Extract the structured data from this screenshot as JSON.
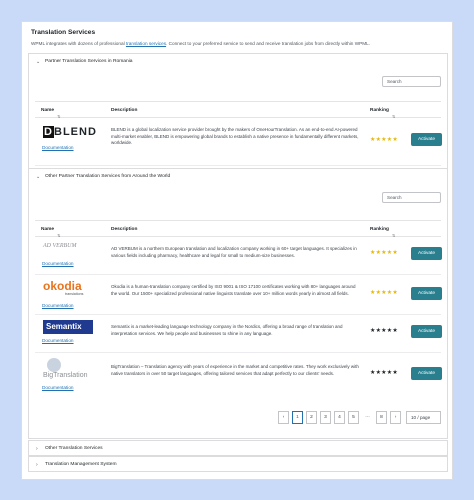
{
  "header": {
    "title": "Translation Services",
    "intro_before": "WPML integrates with dozens of professional",
    "intro_link": "translation services",
    "intro_after": ". Connect to your preferred service to send and receive translation jobs from directly within WPML."
  },
  "section1": {
    "title": "Partner Translation Services in Romania",
    "search_placeholder": "Search",
    "columns": {
      "name": "Name",
      "description": "Description",
      "ranking": "Ranking"
    },
    "rows": [
      {
        "logo_text": "BLEND",
        "doc": "Documentation",
        "description": "BLEND is a global localization service provider brought by the makers of OneHourTranslation. As an end-to-end AI-powered multi-market enabler, BLEND is empowering global brands to establish a native presence in fundamentally different markets, worldwide.",
        "stars": "★★★★★",
        "star_color": "#e5b80b",
        "action": "Activate"
      }
    ]
  },
  "section2": {
    "title": "Other Partner Translation Services from Around the World",
    "search_placeholder": "Search",
    "columns": {
      "name": "Name",
      "description": "Description",
      "ranking": "Ranking"
    },
    "rows": [
      {
        "logo_text": "AD VERBUM",
        "doc": "Documentation",
        "description": "AD VERBUM is a northern European translation and localization company working in 60+ target languages. It specializes in various fields including pharmacy, healthcare and legal for small to medium-size businesses.",
        "stars": "★★★★★",
        "star_color": "#e5b80b",
        "action": "Activate"
      },
      {
        "logo_text": "okodia",
        "logo_sub": "translations",
        "doc": "Documentation",
        "description": "Okodia is a human-translation company certified by ISO 9001 & ISO 17100 certificates working with 80+ languages around the world. Our 1500+ specialized professional native linguists translate over 10+ million words yearly in almost all fields.",
        "stars": "★★★★★",
        "star_color": "#e5b80b",
        "action": "Activate"
      },
      {
        "logo_text": "Semantix",
        "doc": "Documentation",
        "description": "Semantix is a market-leading language technology company in the Nordics, offering a broad range of translation and interpretation services. We help people and businesses to shine in any language.",
        "stars": "★★★★★",
        "star_color": "#1d2327",
        "action": "Activate"
      },
      {
        "logo_text": "BigTranslation",
        "doc": "Documentation",
        "description": "BigTranslation – Translation agency with years of experience in the market and competitive rates. They work exclusively with native translators in over 50 target languages, offering tailored services that adapt perfectly to our clients' needs.",
        "stars": "★★★★★",
        "star_color": "#1d2327",
        "action": "Activate"
      }
    ],
    "pagination": {
      "prev": "‹",
      "pages": [
        "1",
        "2",
        "3",
        "4",
        "5",
        "…",
        "8"
      ],
      "next": "›",
      "per_page": "10 / page"
    }
  },
  "collapsed_sections": [
    {
      "title": "Other Translation Services"
    },
    {
      "title": "Translation Management System"
    }
  ],
  "colors": {
    "accent": "#2a7f8f",
    "link": "#2271b1",
    "background": "#c9daf8"
  }
}
